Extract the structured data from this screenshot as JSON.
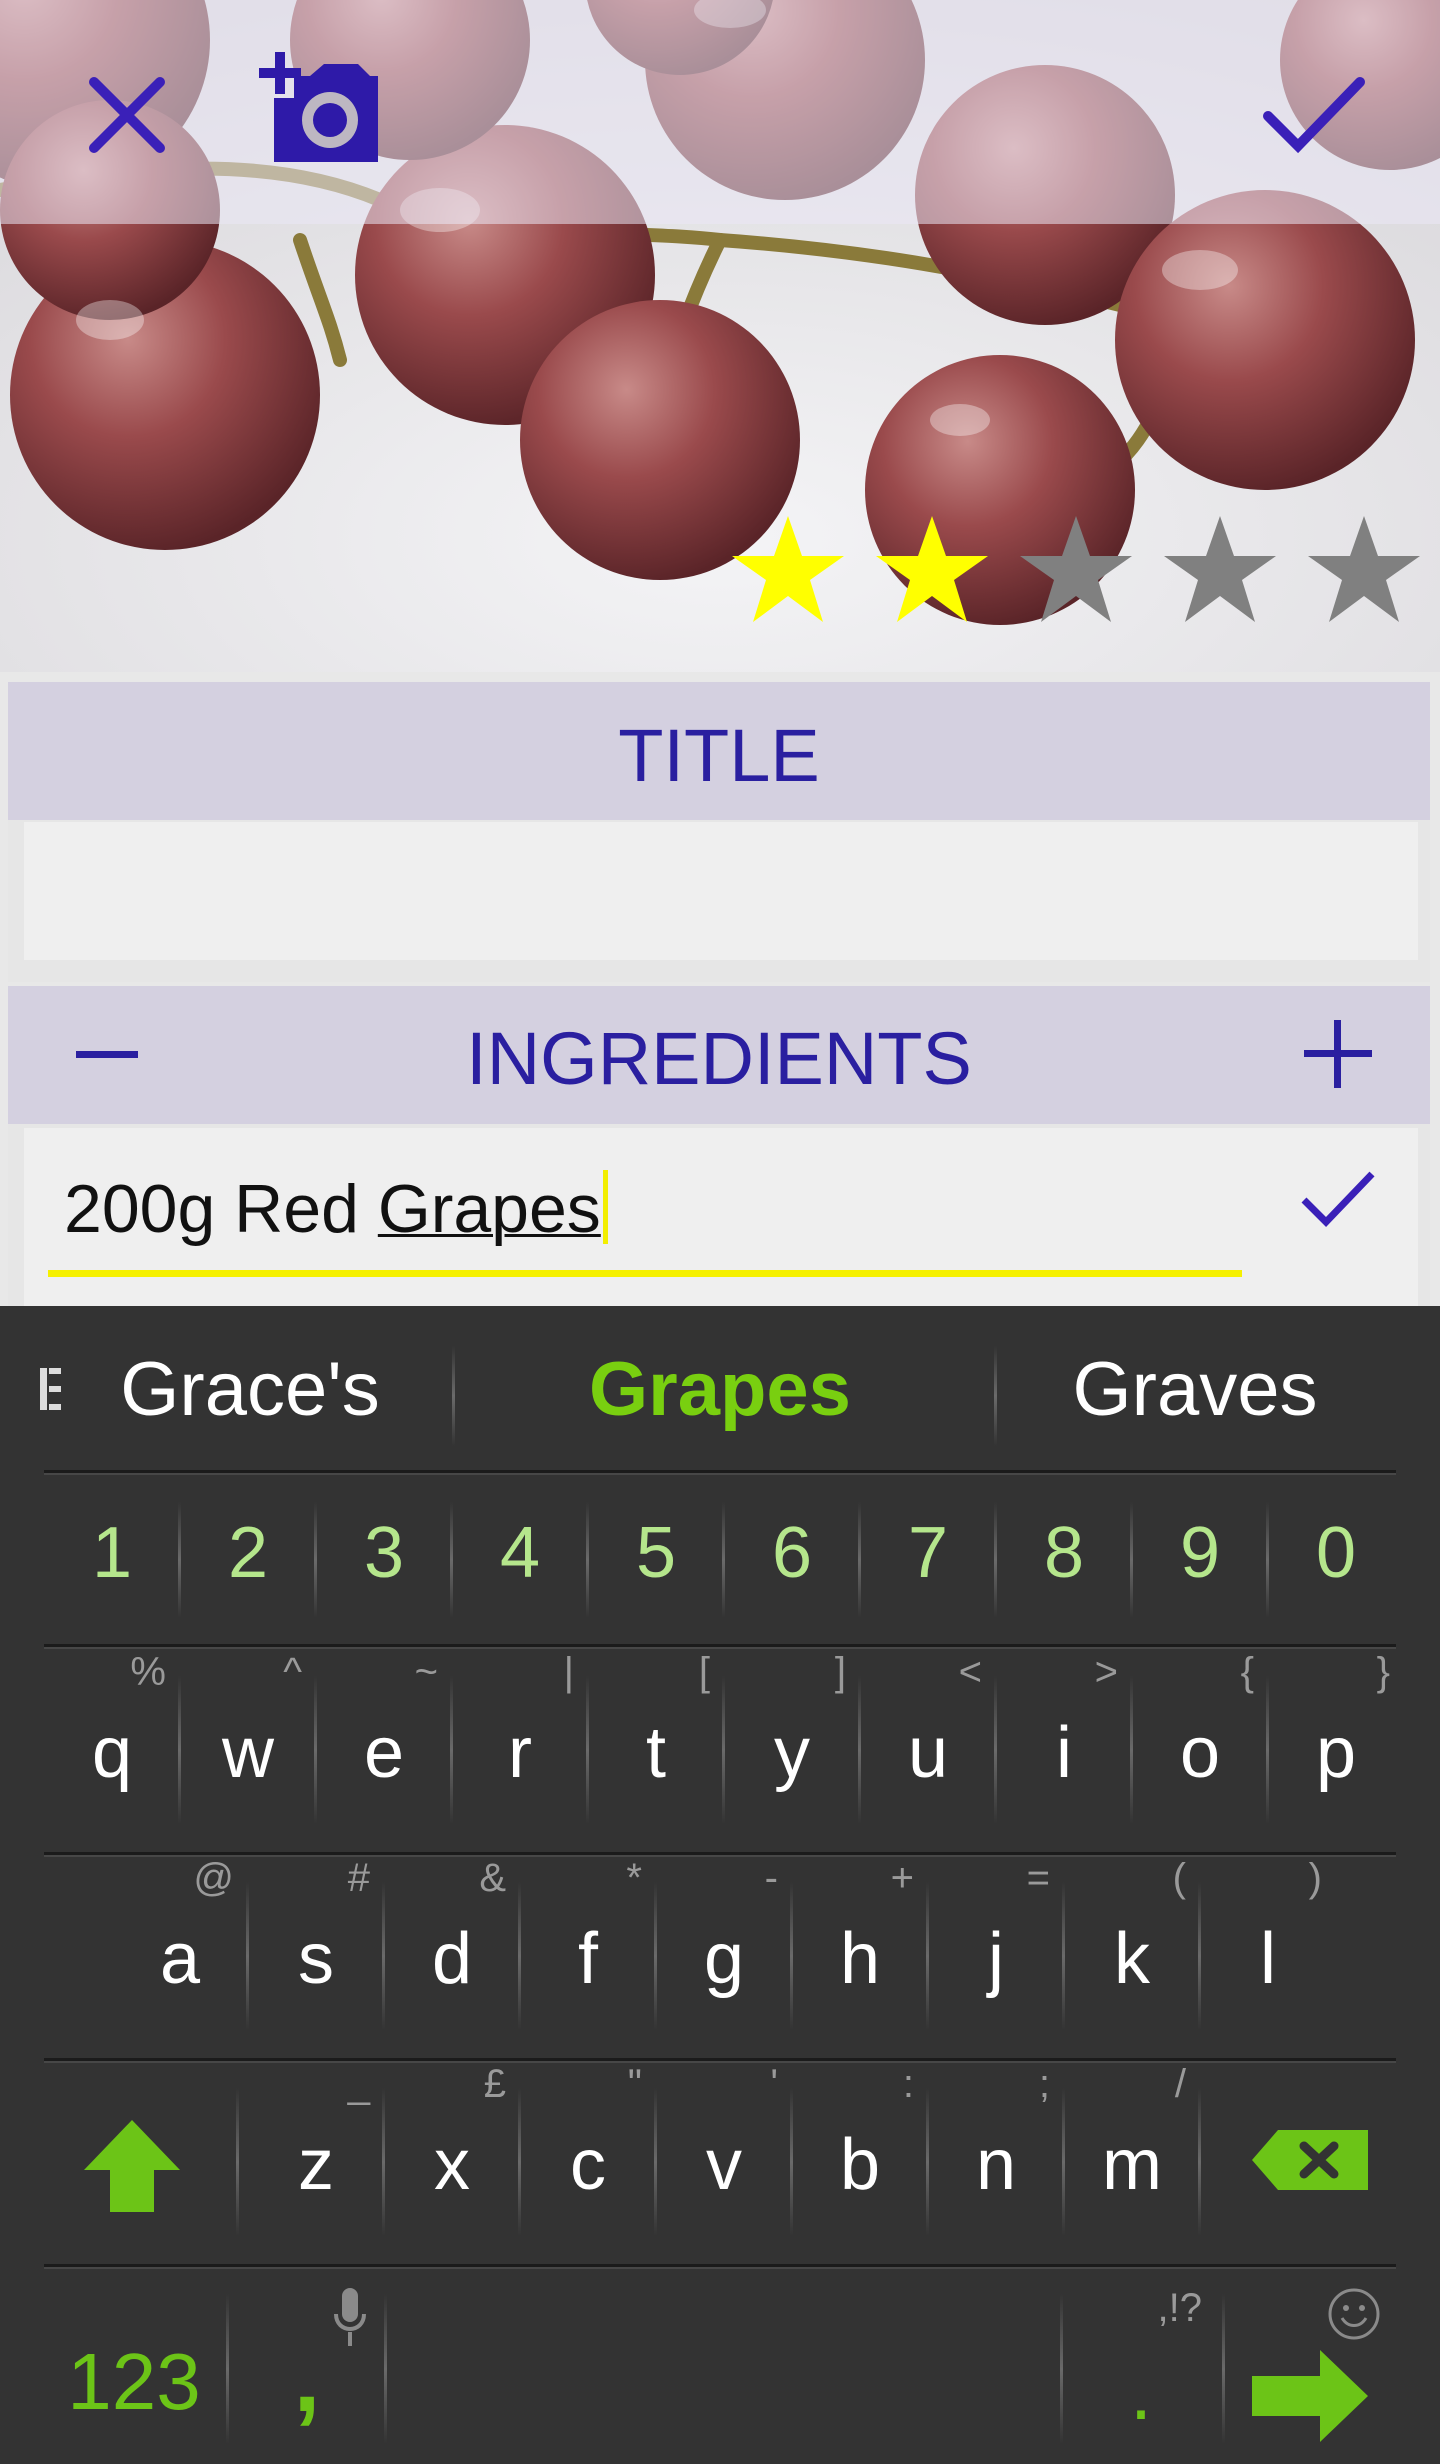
{
  "rating": {
    "value": 2,
    "max": 5,
    "on_color": "#ffff00",
    "off_color": "#808080"
  },
  "toolbar": {
    "close_icon": "close-icon",
    "camera_icon": "add-photo-icon",
    "confirm_icon": "check-icon"
  },
  "title_section": {
    "heading": "TITLE",
    "value": ""
  },
  "ingredients_section": {
    "heading": "INGREDIENTS",
    "entry_prefix": "200g Red ",
    "entry_underlined": "Grapes",
    "entry_value": "200g Red Grapes"
  },
  "keyboard": {
    "suggestions": [
      "Grace's",
      "Grapes",
      "Graves"
    ],
    "numbers": [
      "1",
      "2",
      "3",
      "4",
      "5",
      "6",
      "7",
      "8",
      "9",
      "0"
    ],
    "row1": [
      {
        "k": "q",
        "h": "%"
      },
      {
        "k": "w",
        "h": "^"
      },
      {
        "k": "e",
        "h": "~"
      },
      {
        "k": "r",
        "h": "|"
      },
      {
        "k": "t",
        "h": "["
      },
      {
        "k": "y",
        "h": "]"
      },
      {
        "k": "u",
        "h": "<"
      },
      {
        "k": "i",
        "h": ">"
      },
      {
        "k": "o",
        "h": "{"
      },
      {
        "k": "p",
        "h": "}"
      }
    ],
    "row2": [
      {
        "k": "a",
        "h": "@"
      },
      {
        "k": "s",
        "h": "#"
      },
      {
        "k": "d",
        "h": "&"
      },
      {
        "k": "f",
        "h": "*"
      },
      {
        "k": "g",
        "h": "-"
      },
      {
        "k": "h",
        "h": "+"
      },
      {
        "k": "j",
        "h": "="
      },
      {
        "k": "k",
        "h": "("
      },
      {
        "k": "l",
        "h": ")"
      }
    ],
    "row3": [
      {
        "k": "z",
        "h": "_"
      },
      {
        "k": "x",
        "h": "£"
      },
      {
        "k": "c",
        "h": "\""
      },
      {
        "k": "v",
        "h": "'"
      },
      {
        "k": "b",
        "h": ":"
      },
      {
        "k": "n",
        "h": ";"
      },
      {
        "k": "m",
        "h": "/"
      }
    ],
    "mode_key": "123",
    "comma_key": ",",
    "period_key": ".",
    "period_hint": ",!?",
    "accent_color": "#6cc417"
  }
}
